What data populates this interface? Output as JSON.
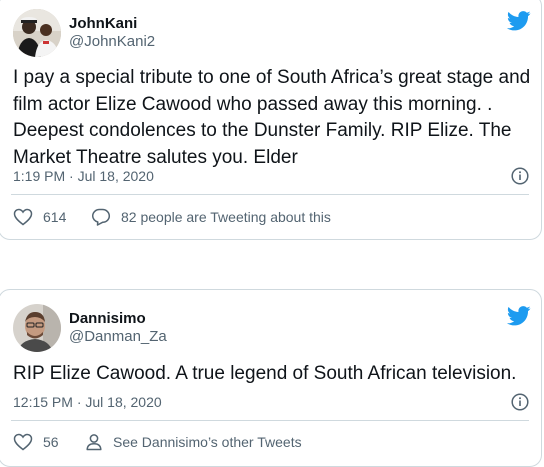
{
  "colors": {
    "accent": "#1d9bf0",
    "text_primary": "#0f1419",
    "text_secondary": "#536471",
    "border": "#cfd9de"
  },
  "tweets": [
    {
      "display_name": "JohnKani",
      "handle": "@JohnKani2",
      "text": "I pay a special tribute to one of South Africa’s great stage and film actor Elize Cawood who passed away this morning. . Deepest condolences to the Dunster Family. RIP Elize. The Market Theatre salutes you. Elder",
      "timestamp": "1:19 PM · Jul 18, 2020",
      "likes": "614",
      "secondary_action": "82 people are Tweeting about this",
      "avatar_icon": "avatar-photo",
      "secondary_icon": "comment-icon"
    },
    {
      "display_name": "Dannisimo",
      "handle": "@Danman_Za",
      "text": "RIP Elize Cawood. A true legend of South African television.",
      "timestamp": "12:15 PM · Jul 18, 2020",
      "likes": "56",
      "secondary_action": "See Dannisimo’s other Tweets",
      "avatar_icon": "avatar-photo",
      "secondary_icon": "person-icon"
    }
  ]
}
